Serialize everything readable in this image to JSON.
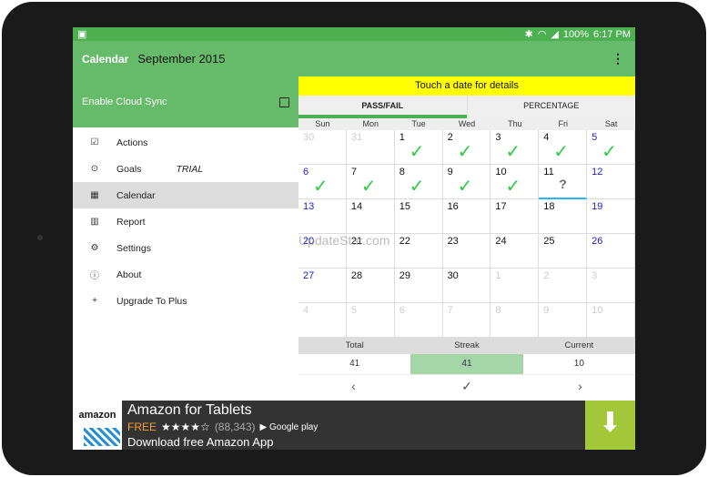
{
  "status": {
    "battery": "100%",
    "time": "6:17 PM"
  },
  "appbar": {
    "section": "Calendar",
    "month": "September 2015",
    "menu_icon": "⋮"
  },
  "drawer": {
    "cloud_sync": "Enable Cloud Sync",
    "items": [
      {
        "label": "Actions",
        "icon": "☑"
      },
      {
        "label": "Goals",
        "icon": "⊙",
        "badge": "TRIAL"
      },
      {
        "label": "Calendar",
        "icon": "▦"
      },
      {
        "label": "Report",
        "icon": "▥"
      },
      {
        "label": "Settings",
        "icon": "⚙"
      },
      {
        "label": "About",
        "icon": "ⓘ"
      },
      {
        "label": "Upgrade To Plus",
        "icon": "+"
      }
    ]
  },
  "calendar": {
    "banner": "Touch a date for details",
    "tabs": [
      "PASS/FAIL",
      "PERCENTAGE"
    ],
    "weekdays": [
      "Sun",
      "Mon",
      "Tue",
      "Wed",
      "Thu",
      "Fri",
      "Sat"
    ],
    "days": [
      {
        "d": "30",
        "out": true
      },
      {
        "d": "31",
        "out": true
      },
      {
        "d": "1",
        "s": "pass"
      },
      {
        "d": "2",
        "s": "pass"
      },
      {
        "d": "3",
        "s": "pass"
      },
      {
        "d": "4",
        "s": "pass"
      },
      {
        "d": "5",
        "s": "pass"
      },
      {
        "d": "6",
        "s": "pass"
      },
      {
        "d": "7",
        "s": "pass"
      },
      {
        "d": "8",
        "s": "pass"
      },
      {
        "d": "9",
        "s": "pass"
      },
      {
        "d": "10",
        "s": "pass"
      },
      {
        "d": "11",
        "s": "unknown",
        "today": true
      },
      {
        "d": "12"
      },
      {
        "d": "13"
      },
      {
        "d": "14"
      },
      {
        "d": "15"
      },
      {
        "d": "16"
      },
      {
        "d": "17"
      },
      {
        "d": "18"
      },
      {
        "d": "19"
      },
      {
        "d": "20"
      },
      {
        "d": "21"
      },
      {
        "d": "22"
      },
      {
        "d": "23"
      },
      {
        "d": "24"
      },
      {
        "d": "25"
      },
      {
        "d": "26"
      },
      {
        "d": "27"
      },
      {
        "d": "28"
      },
      {
        "d": "29"
      },
      {
        "d": "30"
      },
      {
        "d": "1",
        "out": true
      },
      {
        "d": "2",
        "out": true
      },
      {
        "d": "3",
        "out": true
      },
      {
        "d": "4",
        "out": true
      },
      {
        "d": "5",
        "out": true
      },
      {
        "d": "6",
        "out": true
      },
      {
        "d": "7",
        "out": true
      },
      {
        "d": "8",
        "out": true
      },
      {
        "d": "9",
        "out": true
      },
      {
        "d": "10",
        "out": true
      }
    ],
    "stats": {
      "headers": [
        "Total",
        "Streak",
        "Current"
      ],
      "values": [
        "41",
        "41",
        "10"
      ]
    },
    "nav": {
      "prev": "‹",
      "mark": "✓",
      "next": "›"
    }
  },
  "watermark": "UpdateStar.com",
  "ad": {
    "logo": "amazon",
    "title": "Amazon for Tablets",
    "price": "FREE",
    "stars": "★★★★☆",
    "reviews": "(88,343)",
    "store": "▶ Google play",
    "subtitle": "Download free Amazon App",
    "download_icon": "⬇"
  }
}
